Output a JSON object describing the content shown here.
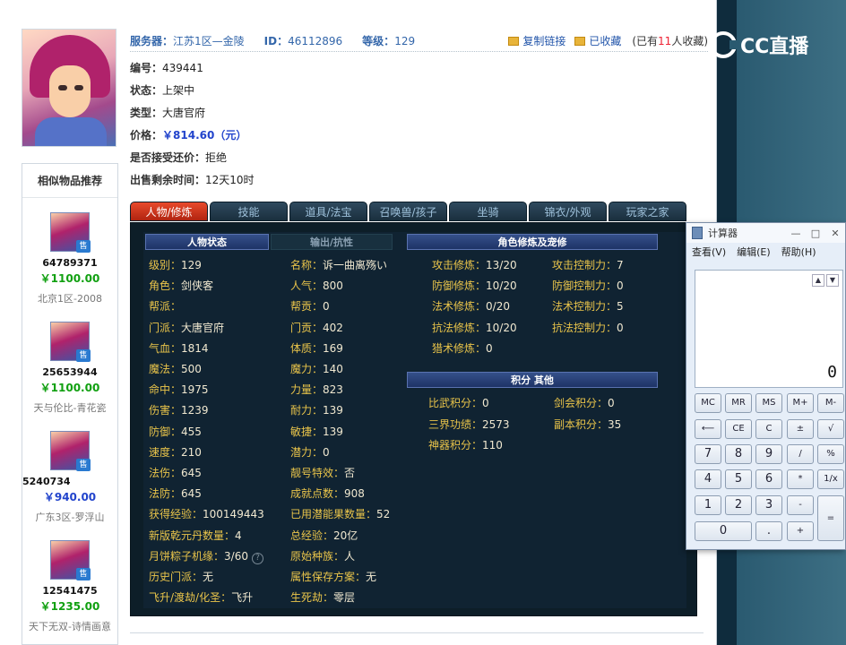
{
  "header": {
    "server_label": "服务器：",
    "server_value": "江苏1区—金陵",
    "id_label": "ID：",
    "id_value": "46112896",
    "level_label": "等级：",
    "level_value": "129",
    "copy_link": "复制链接",
    "favorited": "已收藏",
    "fav_count_prefix": "(已有",
    "fav_count": "11",
    "fav_count_suffix": "人收藏)"
  },
  "info": {
    "number_label": "编号：",
    "number_value": "439441",
    "status_label": "状态：",
    "status_value": "上架中",
    "type_label": "类型：",
    "type_value": "大唐官府",
    "price_label": "价格：",
    "price_value": "￥814.60（元）",
    "bargain_label": "是否接受还价：",
    "bargain_value": "拒绝",
    "remaining_label": "出售剩余时间：",
    "remaining_value": "12天10时"
  },
  "similar": {
    "title": "相似物品推荐",
    "items": [
      {
        "id": "64789371",
        "price": "￥1100.00",
        "server": "北京1区-2008",
        "tag": "售"
      },
      {
        "id": "25653944",
        "price": "￥1100.00",
        "server": "天与伦比-青花瓷",
        "tag": "售"
      },
      {
        "id": "5240734",
        "price": "￥940.00",
        "server": "广东3区-罗浮山",
        "tag": "售"
      },
      {
        "id": "12541475",
        "price": "￥1235.00",
        "server": "天下无双-诗情画意",
        "tag": "售"
      }
    ]
  },
  "tabs": [
    "人物/修炼",
    "技能",
    "道具/法宝",
    "召唤兽/孩子",
    "坐骑",
    "锦衣/外观",
    "玩家之家"
  ],
  "panel": {
    "hdr_status": "人物状态",
    "hdr_resist": "输出/抗性",
    "hdr_cultivation": "角色修炼及宠修",
    "hdr_points": "积分 其他",
    "left": [
      {
        "k": "级别：",
        "v": "129"
      },
      {
        "k": "角色：",
        "v": "剑侠客"
      },
      {
        "k": "帮派：",
        "v": ""
      },
      {
        "k": "门派：",
        "v": "大唐官府"
      },
      {
        "k": "气血：",
        "v": "1814"
      },
      {
        "k": "魔法：",
        "v": "500"
      },
      {
        "k": "命中：",
        "v": "1975"
      },
      {
        "k": "伤害：",
        "v": "1239"
      },
      {
        "k": "防御：",
        "v": "455"
      },
      {
        "k": "速度：",
        "v": "210"
      },
      {
        "k": "法伤：",
        "v": "645"
      },
      {
        "k": "法防：",
        "v": "645"
      },
      {
        "k": "获得经验：",
        "v": "100149443"
      },
      {
        "k": "新版乾元丹数量：",
        "v": "4"
      },
      {
        "k": "月饼粽子机缘：",
        "v": "3/60"
      },
      {
        "k": "历史门派：",
        "v": "无"
      },
      {
        "k": "飞升/渡劫/化圣：",
        "v": "飞升"
      }
    ],
    "mid": [
      {
        "k": "名称：",
        "v": "诉一曲离殇い"
      },
      {
        "k": "人气：",
        "v": "800"
      },
      {
        "k": "帮贡：",
        "v": "0"
      },
      {
        "k": "门贡：",
        "v": "402"
      },
      {
        "k": "体质：",
        "v": "169"
      },
      {
        "k": "魔力：",
        "v": "140"
      },
      {
        "k": "力量：",
        "v": "823"
      },
      {
        "k": "耐力：",
        "v": "139"
      },
      {
        "k": "敏捷：",
        "v": "139"
      },
      {
        "k": "潜力：",
        "v": "0"
      },
      {
        "k": "靓号特效：",
        "v": "否"
      },
      {
        "k": "成就点数：",
        "v": "908"
      },
      {
        "k": "已用潜能果数量：",
        "v": "52"
      },
      {
        "k": "总经验：",
        "v": "20亿"
      },
      {
        "k": "原始种族：",
        "v": "人"
      },
      {
        "k": "属性保存方案：",
        "v": "无"
      },
      {
        "k": "生死劫：",
        "v": "零层"
      }
    ],
    "cultivation_left": [
      {
        "k": "攻击修炼：",
        "v": "13/20"
      },
      {
        "k": "防御修炼：",
        "v": "10/20"
      },
      {
        "k": "法术修炼：",
        "v": "0/20"
      },
      {
        "k": "抗法修炼：",
        "v": "10/20"
      },
      {
        "k": "猎术修炼：",
        "v": "0"
      }
    ],
    "cultivation_right": [
      {
        "k": "攻击控制力：",
        "v": "7"
      },
      {
        "k": "防御控制力：",
        "v": "0"
      },
      {
        "k": "法术控制力：",
        "v": "5"
      },
      {
        "k": "抗法控制力：",
        "v": "0"
      }
    ],
    "points_left": [
      {
        "k": "比武积分：",
        "v": "0"
      },
      {
        "k": "三界功绩：",
        "v": "2573"
      },
      {
        "k": "神器积分：",
        "v": "110"
      }
    ],
    "points_right": [
      {
        "k": "剑会积分：",
        "v": "0"
      },
      {
        "k": "副本积分：",
        "v": "35"
      }
    ],
    "help_icon": "?"
  },
  "watermark": {
    "text": "CC直播"
  },
  "calculator": {
    "title": "计算器",
    "menu": [
      "查看(V)",
      "编辑(E)",
      "帮助(H)"
    ],
    "display": "0",
    "window_buttons": [
      "—",
      "□",
      "✕"
    ],
    "arrows": [
      "▲",
      "▼"
    ],
    "keys": [
      {
        "label": "MC"
      },
      {
        "label": "MR"
      },
      {
        "label": "MS"
      },
      {
        "label": "M+"
      },
      {
        "label": "M-"
      },
      {
        "label": "⟵"
      },
      {
        "label": "CE"
      },
      {
        "label": "C"
      },
      {
        "label": "±"
      },
      {
        "label": "√"
      },
      {
        "label": "7"
      },
      {
        "label": "8"
      },
      {
        "label": "9"
      },
      {
        "label": "/"
      },
      {
        "label": "%"
      },
      {
        "label": "4"
      },
      {
        "label": "5"
      },
      {
        "label": "6"
      },
      {
        "label": "*"
      },
      {
        "label": "1/x"
      },
      {
        "label": "1"
      },
      {
        "label": "2"
      },
      {
        "label": "3"
      },
      {
        "label": "-"
      },
      {
        "label": "="
      },
      {
        "label": "0"
      },
      {
        "label": "."
      },
      {
        "label": "+"
      }
    ]
  }
}
